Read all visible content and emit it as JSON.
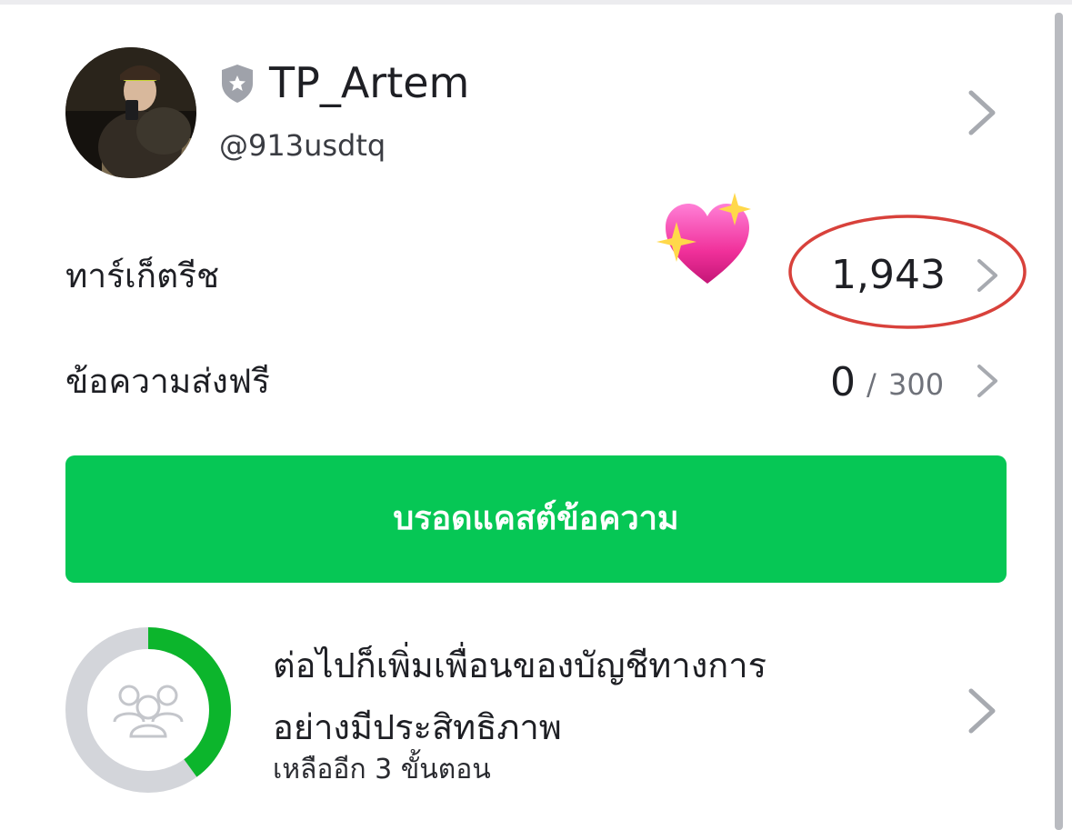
{
  "profile": {
    "name": "TP_Artem",
    "handle": "@913usdtq",
    "avatar_icon": "profile-photo",
    "badge_icon": "shield-star-icon"
  },
  "stats": {
    "friends_label": "ทาร์เก็ตรีช",
    "friends_count": "1,943",
    "messages_label": "ข้อความส่งฟรี",
    "messages_used": "0",
    "messages_separator": "/",
    "messages_quota": "300"
  },
  "decorations": {
    "emoji": "sparkling-heart",
    "highlight": "red-oval"
  },
  "broadcast": {
    "label": "บรอดแคสต์ข้อความ"
  },
  "onboarding": {
    "title_line1": "ต่อไปก็เพิ่มเพื่อนของบัญชีทางการ",
    "title_line2": "อย่างมีประสิทธิภาพ",
    "subtitle": "เหลืออีก 3 ขั้นตอน",
    "progress_fraction": 0.4,
    "icon": "friends-group-icon"
  },
  "colors": {
    "accent": "#06c755",
    "ring_track": "#d3d5da",
    "ring_fill": "#0cb52c",
    "oval": "#d8413b",
    "chevron": "#a7aab0"
  }
}
